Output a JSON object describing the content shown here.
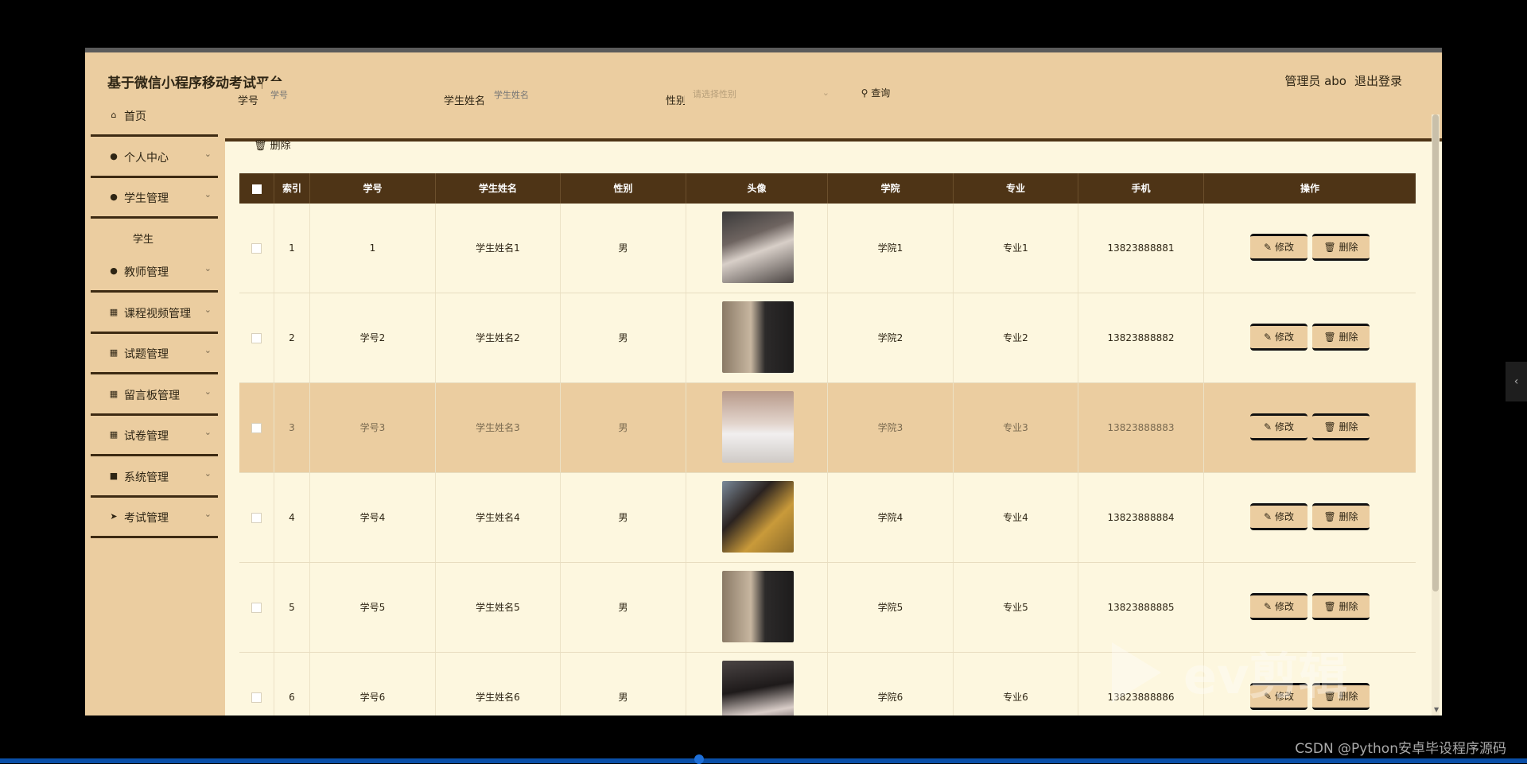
{
  "header": {
    "title": "基于微信小程序移动考试平台",
    "user": "管理员 abo",
    "logout": "退出登录"
  },
  "sidebar": {
    "items": [
      {
        "label": "首页",
        "icon": "home-icon"
      },
      {
        "label": "个人中心",
        "icon": "person-icon"
      },
      {
        "label": "学生管理",
        "icon": "person-icon"
      },
      {
        "label": "教师管理",
        "icon": "bulb-icon"
      },
      {
        "label": "课程视频管理",
        "icon": "grid-icon"
      },
      {
        "label": "试题管理",
        "icon": "grid-icon"
      },
      {
        "label": "留言板管理",
        "icon": "grid-icon"
      },
      {
        "label": "试卷管理",
        "icon": "grid-icon"
      },
      {
        "label": "系统管理",
        "icon": "trash-icon"
      },
      {
        "label": "考试管理",
        "icon": "send-icon"
      }
    ],
    "sub_student": "学生"
  },
  "search": {
    "student_no_label": "学号",
    "student_no_placeholder": "学号",
    "student_name_label": "学生姓名",
    "student_name_placeholder": "学生姓名",
    "gender_label": "性别",
    "gender_placeholder": "请选择性别",
    "query": "查询"
  },
  "toolbar": {
    "delete": "删除"
  },
  "table": {
    "headers": [
      "索引",
      "学号",
      "学生姓名",
      "性别",
      "头像",
      "学院",
      "专业",
      "手机",
      "操作"
    ],
    "rows": [
      {
        "index": "1",
        "no": "1",
        "name": "学生姓名1",
        "gender": "男",
        "college": "学院1",
        "major": "专业1",
        "phone": "13823888881"
      },
      {
        "index": "2",
        "no": "学号2",
        "name": "学生姓名2",
        "gender": "男",
        "college": "学院2",
        "major": "专业2",
        "phone": "13823888882"
      },
      {
        "index": "3",
        "no": "学号3",
        "name": "学生姓名3",
        "gender": "男",
        "college": "学院3",
        "major": "专业3",
        "phone": "13823888883"
      },
      {
        "index": "4",
        "no": "学号4",
        "name": "学生姓名4",
        "gender": "男",
        "college": "学院4",
        "major": "专业4",
        "phone": "13823888884"
      },
      {
        "index": "5",
        "no": "学号5",
        "name": "学生姓名5",
        "gender": "男",
        "college": "学院5",
        "major": "专业5",
        "phone": "13823888885"
      },
      {
        "index": "6",
        "no": "学号6",
        "name": "学生姓名6",
        "gender": "男",
        "college": "学院6",
        "major": "专业6",
        "phone": "13823888886"
      }
    ],
    "edit_label": "修改",
    "delete_label": "删除"
  },
  "watermark": "ev剪辑",
  "credit": "CSDN @Python安卓毕设程序源码"
}
